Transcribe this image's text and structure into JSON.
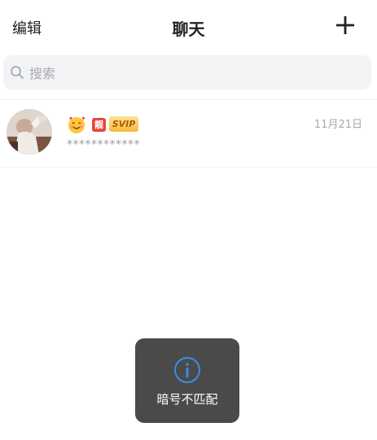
{
  "nav": {
    "edit_label": "编辑",
    "title": "聊天",
    "add_icon": "plus-icon"
  },
  "search": {
    "placeholder": "搜索",
    "icon": "search-icon"
  },
  "chats": [
    {
      "avatar": "avatar-photo",
      "emoji_icon": "smiling-face-hearts-icon",
      "badge_guan": "靓",
      "badge_svip": "SVIP",
      "preview": "************",
      "date": "11月21日"
    }
  ],
  "toast": {
    "icon": "info-icon",
    "text": "暗号不匹配"
  },
  "colors": {
    "toast_bg": "#4a4a4a",
    "toast_icon": "#3a8ee6",
    "badge_red": "#e8453c",
    "svip_gold": "#f5b93b",
    "search_bg": "#f2f3f5"
  }
}
